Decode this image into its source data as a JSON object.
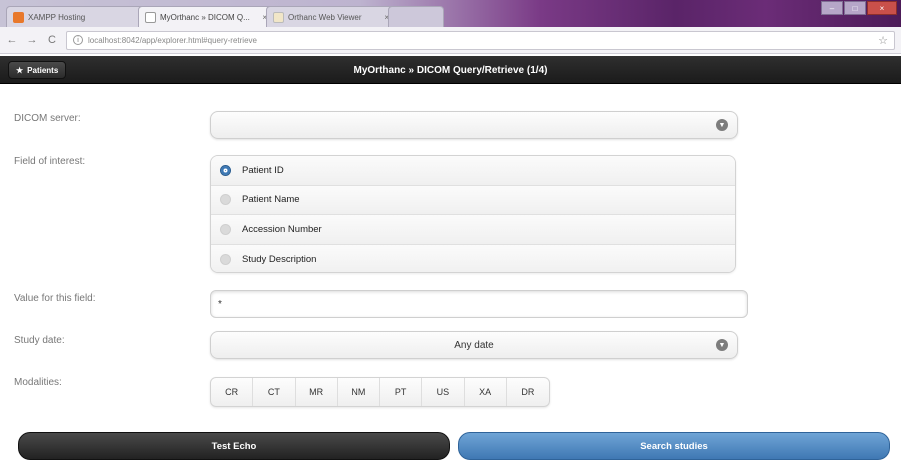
{
  "browser": {
    "tabs": [
      {
        "title": "XAMPP Hosting",
        "close": "×",
        "color": "#e8782b"
      },
      {
        "title": "MyOrthanc » DICOM Q...",
        "close": "×",
        "color": "#ffffff"
      },
      {
        "title": "Orthanc Web Viewer",
        "close": "×",
        "color": "#f1e6c8"
      }
    ],
    "url": "localhost:8042/app/explorer.html#query-retrieve",
    "back": "←",
    "forward": "→",
    "reload": "C",
    "star": "☆"
  },
  "header": {
    "patients_button": "Patients",
    "patients_icon": "home-icon",
    "title": "MyOrthanc » DICOM Query/Retrieve (1/4)"
  },
  "form": {
    "dicom_server_label": "DICOM server:",
    "dicom_server_value": "",
    "field_of_interest_label": "Field of interest:",
    "fields": [
      {
        "label": "Patient ID",
        "selected": true
      },
      {
        "label": "Patient Name",
        "selected": false
      },
      {
        "label": "Accession Number",
        "selected": false
      },
      {
        "label": "Study Description",
        "selected": false
      }
    ],
    "value_label": "Value for this field:",
    "value": "*",
    "study_date_label": "Study date:",
    "study_date_value": "Any date",
    "modalities_label": "Modalities:",
    "modalities": [
      "CR",
      "CT",
      "MR",
      "NM",
      "PT",
      "US",
      "XA",
      "DR"
    ]
  },
  "actions": {
    "test_echo": "Test Echo",
    "search_studies": "Search studies"
  },
  "colors": {
    "header_bg": "#1b1b1b",
    "primary_button": "#3f78b3",
    "secondary_button": "#222222"
  }
}
